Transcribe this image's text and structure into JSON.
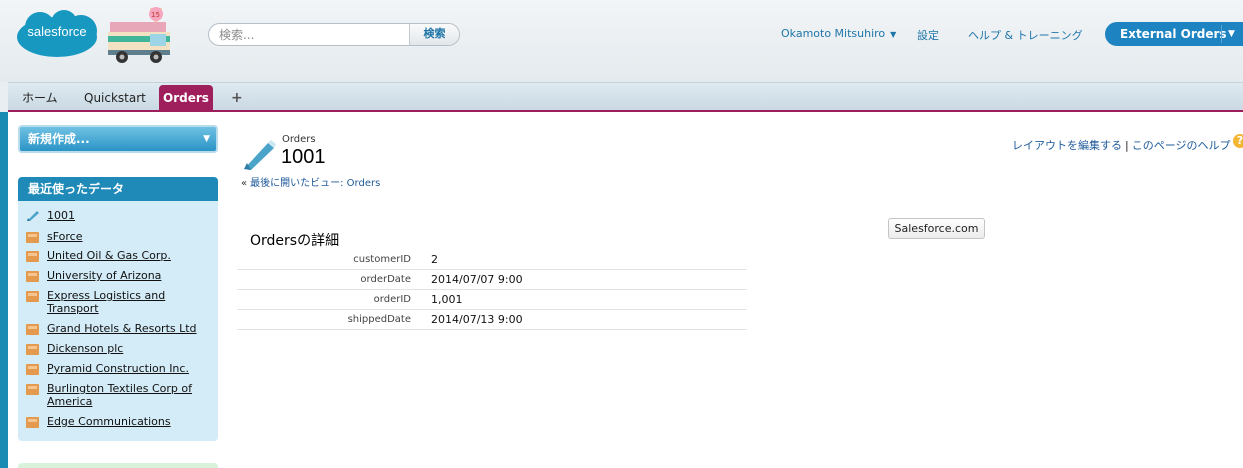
{
  "header": {
    "logo_text": "salesforce",
    "search": {
      "placeholder": "検索...",
      "button_label": "検索"
    },
    "user_menu": "Okamoto Mitsuhiro",
    "settings_label": "設定",
    "help_label": "ヘルプ & トレーニング",
    "app_switcher": "External Orders",
    "colors": {
      "accent": "#1d83c1",
      "tab_active": "#9f1f5c"
    }
  },
  "tabs": {
    "home": "ホーム",
    "quickstart": "Quickstart",
    "orders": "Orders",
    "add": "+"
  },
  "sidebar": {
    "create_new": "新規作成...",
    "recent_header": "最近使ったデータ",
    "recent_items": [
      {
        "label": "1001",
        "icon": "order-icon"
      },
      {
        "label": "sForce",
        "icon": "account-icon"
      },
      {
        "label": "United Oil & Gas Corp.",
        "icon": "account-icon"
      },
      {
        "label": "University of Arizona",
        "icon": "account-icon"
      },
      {
        "label": "Express Logistics and Transport",
        "icon": "account-icon"
      },
      {
        "label": "Grand Hotels & Resorts Ltd",
        "icon": "account-icon"
      },
      {
        "label": "Dickenson plc",
        "icon": "account-icon"
      },
      {
        "label": "Pyramid Construction Inc.",
        "icon": "account-icon"
      },
      {
        "label": "Burlington Textiles Corp of America",
        "icon": "account-icon"
      },
      {
        "label": "Edge Communications",
        "icon": "account-icon"
      }
    ]
  },
  "record": {
    "object_type": "Orders",
    "name": "1001",
    "back_link": "最後に開いたビュー: Orders",
    "edit_layout": "レイアウトを編集する",
    "page_help": "このページのヘルプ",
    "external_button": "Salesforce.com",
    "section_title": "Ordersの詳細",
    "fields": [
      {
        "label": "customerID",
        "value": "2"
      },
      {
        "label": "orderDate",
        "value": "2014/07/07 9:00"
      },
      {
        "label": "orderID",
        "value": "1,001"
      },
      {
        "label": "shippedDate",
        "value": "2014/07/13 9:00"
      }
    ]
  }
}
